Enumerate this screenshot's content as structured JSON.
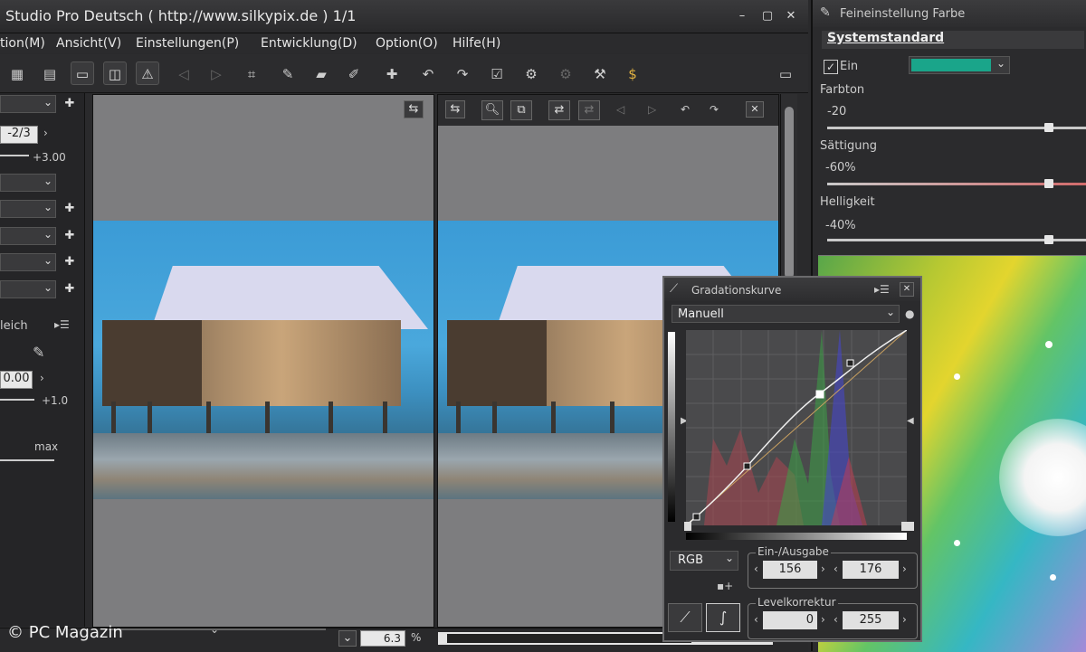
{
  "window": {
    "title": "Studio Pro Deutsch ( http://www.silkypix.de )   1/1"
  },
  "menu": [
    "tion(M)",
    "Ansicht(V)",
    "Einstellungen(P)",
    "Entwicklung(D)",
    "Option(O)",
    "Hilfe(H)"
  ],
  "left": {
    "ev_value": "-2/3",
    "ev_max": "+3.00",
    "section_label": "leich",
    "wb_value": "0.00",
    "wb_max": "+1.0",
    "max_label": "max"
  },
  "viewer": {
    "zoom_value": "6.3",
    "zoom_unit": "%"
  },
  "watermark": "© PC Magazin",
  "right": {
    "title": "Feineinstellung Farbe",
    "preset": "Systemstandard",
    "enable_label": "Ein",
    "swatch_color": "#1aa58a",
    "hue_label": "Farbton",
    "hue_value": "-20",
    "sat_label": "Sättigung",
    "sat_value": "-60%",
    "bright_label": "Helligkeit",
    "bright_value": "-40%"
  },
  "curve": {
    "title": "Gradationskurve",
    "mode": "Manuell",
    "channel": "RGB",
    "io_label": "Ein-/Ausgabe",
    "input": "156",
    "output": "176",
    "level_label": "Levelkorrektur",
    "level_low": "0",
    "level_high": "255"
  }
}
